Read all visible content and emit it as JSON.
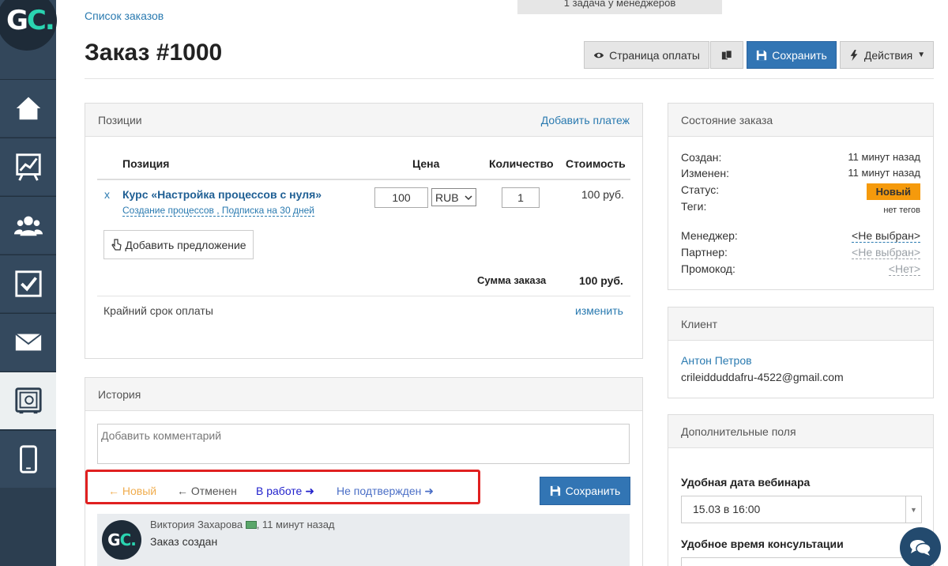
{
  "nav": {
    "logo_g": "G",
    "logo_c": "C.",
    "items": [
      "home-icon",
      "chart-icon",
      "users-icon",
      "checkbox-icon",
      "mail-icon",
      "safe-icon",
      "mobile-icon"
    ]
  },
  "header": {
    "breadcrumb": "Список заказов",
    "tasks": "1 задача у менеджеров",
    "title": "Заказ #1000",
    "btn_payment_page": "Страница оплаты",
    "btn_save": "Сохранить",
    "btn_actions": "Действия"
  },
  "positions": {
    "title": "Позиции",
    "add_payment": "Добавить платеж",
    "col_position": "Позиция",
    "col_price": "Цена",
    "col_qty": "Количество",
    "col_cost": "Стоимость",
    "remove": "x",
    "item_name": "Курс «Настройка процессов с нуля»",
    "item_sub": "Создание процессов , Подписка на 30 дней",
    "price": "100",
    "currency": "RUB",
    "qty": "1",
    "cost": "100 руб.",
    "add_offer": "Добавить предложение",
    "sum_label": "Сумма заказа",
    "sum_value": "100 руб.",
    "deadline_label": "Крайний срок оплаты",
    "deadline_change": "изменить"
  },
  "history": {
    "title": "История",
    "comment_placeholder": "Добавить комментарий",
    "status_new": "Новый",
    "status_cancelled": "Отменен",
    "status_in_work": "В работе",
    "status_unconfirmed": "Не подтвержден",
    "save": "Сохранить",
    "entry_author": "Виктория Захарова",
    "entry_time": ", 11 минут назад",
    "entry_text": "Заказ создан"
  },
  "order_state": {
    "title": "Состояние заказа",
    "created_label": "Создан:",
    "created_value": "11 минут назад",
    "changed_label": "Изменен:",
    "changed_value": "11 минут назад",
    "status_label": "Статус:",
    "status_value": "Новый",
    "tags_label": "Теги:",
    "tags_value": "нет тегов",
    "manager_label": "Менеджер:",
    "manager_value": "<Не выбран>",
    "partner_label": "Партнер:",
    "partner_value": "<Не выбран>",
    "promo_label": "Промокод:",
    "promo_value": "<Нет>"
  },
  "client": {
    "title": "Клиент",
    "name": "Антон Петров",
    "email": "crileidduddafru-4522@gmail.com"
  },
  "extra_fields": {
    "title": "Дополнительные поля",
    "webinar_label": "Удобная дата вебинара",
    "webinar_value": "15.03 в 16:00",
    "consult_label": "Удобное время консультации"
  },
  "colors": {
    "sidebar": "#2c3e50",
    "primary": "#3275b4",
    "link": "#2a7ab0",
    "badge": "#f59a0c",
    "highlight": "#e02020"
  }
}
